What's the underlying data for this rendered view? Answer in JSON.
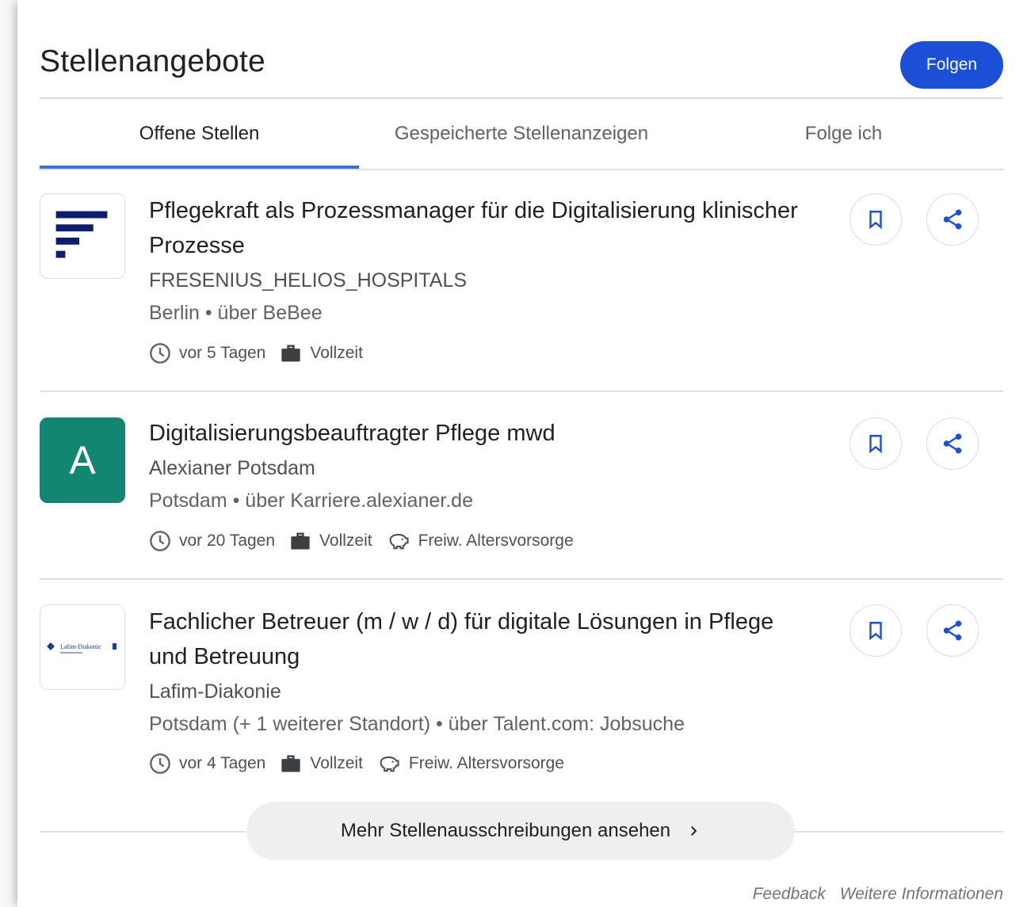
{
  "header": {
    "title": "Stellenangebote",
    "follow_label": "Folgen"
  },
  "tabs": [
    {
      "label": "Offene Stellen",
      "active": true
    },
    {
      "label": "Gespeicherte Stellenanzeigen",
      "active": false
    },
    {
      "label": "Folge ich",
      "active": false
    }
  ],
  "jobs": [
    {
      "title_line1": "Pflegekraft als Prozessmanager für die Digitalisierung klinischer",
      "title_line2": "Prozesse",
      "company": "FRESENIUS_HELIOS_HOSPITALS",
      "location": "Berlin • über BeBee",
      "posted": "vor 5 Tagen",
      "type": "Vollzeit",
      "logo": "bars-logo"
    },
    {
      "title_line1": "Digitalisierungsbeauftragter Pflege mwd",
      "company": "Alexianer Potsdam",
      "location": "Potsdam • über Karriere.alexianer.de",
      "posted": "vor 20 Tagen",
      "type": "Vollzeit",
      "benefit": "Freiw. Altersvorsorge",
      "logo_letter": "A"
    },
    {
      "title_line1": "Fachlicher Betreuer (m / w / d) für digitale Lösungen in Pflege",
      "title_line2": "und Betreuung",
      "company": "Lafim-Diakonie",
      "location": "Potsdam (+ 1 weiterer Standort) • über Talent.com: Jobsuche",
      "posted": "vor 4 Tagen",
      "type": "Vollzeit",
      "benefit": "Freiw. Altersvorsorge",
      "logo_text": "Lafim-Diakonie"
    }
  ],
  "more_label": "Mehr Stellenausschreibungen ansehen",
  "footer": {
    "feedback": "Feedback",
    "more_info": "Weitere Informationen"
  },
  "colors": {
    "accent": "#1a4fd6",
    "tab_indicator": "#3b6fdc",
    "alexianer_green": "#138672",
    "icon_blue": "#1a4fd6"
  }
}
